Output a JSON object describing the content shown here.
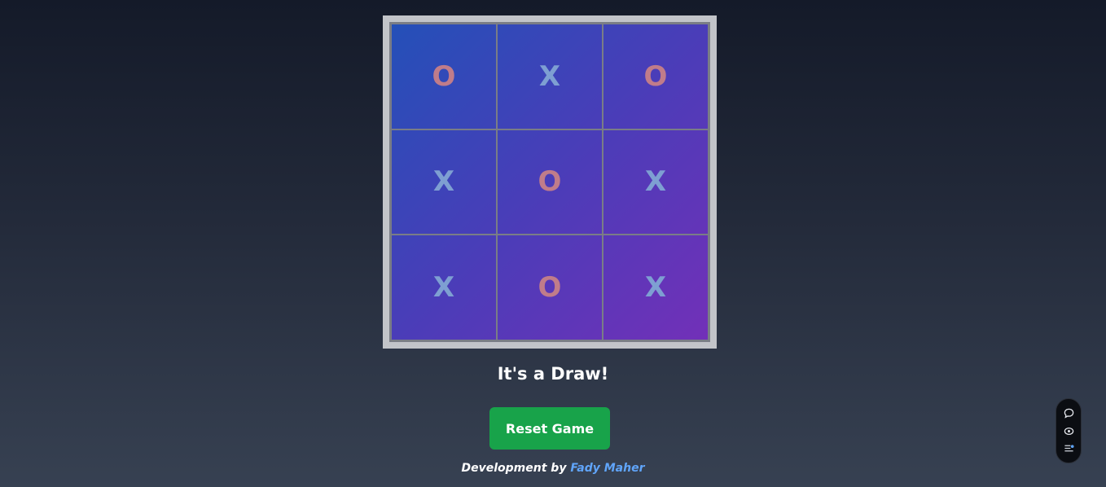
{
  "board": {
    "cells": [
      "O",
      "X",
      "O",
      "X",
      "O",
      "X",
      "X",
      "O",
      "X"
    ]
  },
  "status": "It's a Draw!",
  "reset_label": "Reset Game",
  "footer": {
    "prefix": "Development by",
    "author": "Fady Maher"
  },
  "colors": {
    "x_mark": "#7e9fd2",
    "o_mark": "#c07c8a",
    "reset_button": "#18a34a",
    "author_link": "#60a5fa"
  },
  "side_widget": {
    "icons": [
      "chat-bubble-icon",
      "eye-icon",
      "list-settings-icon"
    ]
  }
}
